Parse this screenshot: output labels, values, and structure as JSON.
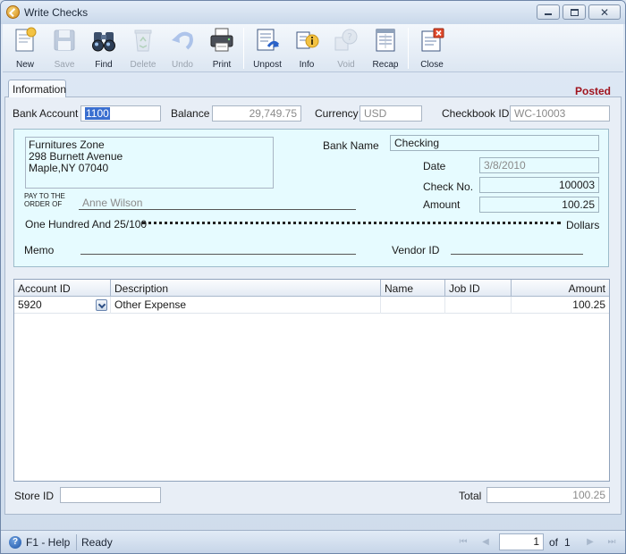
{
  "window": {
    "title": "Write Checks"
  },
  "toolbar": {
    "buttons": [
      {
        "label": "New",
        "icon": "new-document-icon",
        "enabled": true
      },
      {
        "label": "Save",
        "icon": "floppy-disk-icon",
        "enabled": false
      },
      {
        "label": "Find",
        "icon": "binoculars-icon",
        "enabled": true
      },
      {
        "label": "Delete",
        "icon": "recycle-bin-icon",
        "enabled": false
      },
      {
        "label": "Undo",
        "icon": "undo-arrow-icon",
        "enabled": false
      },
      {
        "label": "Print",
        "icon": "printer-icon",
        "enabled": true
      },
      {
        "label": "Unpost",
        "icon": "unpost-ledger-icon",
        "enabled": true
      },
      {
        "label": "Info",
        "icon": "info-icon",
        "enabled": true
      },
      {
        "label": "Void",
        "icon": "void-icon",
        "enabled": false
      },
      {
        "label": "Recap",
        "icon": "recap-ledger-icon",
        "enabled": true
      },
      {
        "label": "Close",
        "icon": "close-window-icon",
        "enabled": true
      }
    ]
  },
  "tab": {
    "label": "Information"
  },
  "status_badge": "Posted",
  "header": {
    "bank_account_label": "Bank Account",
    "bank_account_value": "1100",
    "balance_label": "Balance",
    "balance_value": "29,749.75",
    "currency_label": "Currency",
    "currency_value": "USD",
    "checkbook_id_label": "Checkbook ID",
    "checkbook_id_value": "WC-10003"
  },
  "check": {
    "address_line1": "Furnitures Zone",
    "address_line2": "298 Burnett Avenue",
    "address_line3": "Maple,NY 07040",
    "bank_name_label": "Bank Name",
    "bank_name_value": "Checking",
    "date_label": "Date",
    "date_value": "3/8/2010",
    "check_no_label": "Check No.",
    "check_no_value": "100003",
    "amount_label": "Amount",
    "amount_value": "100.25",
    "pay_to_line1": "PAY TO THE",
    "pay_to_line2": "ORDER OF",
    "payee": "Anne Wilson",
    "amount_words": "One Hundred  And 25/100",
    "dollars_label": "Dollars",
    "memo_label": "Memo",
    "memo_value": "",
    "vendor_id_label": "Vendor ID",
    "vendor_id_value": ""
  },
  "grid": {
    "columns": [
      "Account ID",
      "Description",
      "Name",
      "Job ID",
      "Amount"
    ],
    "rows": [
      {
        "account_id": "5920",
        "description": "Other Expense",
        "name": "",
        "job_id": "",
        "amount": "100.25"
      }
    ]
  },
  "footer": {
    "store_id_label": "Store ID",
    "store_id_value": "",
    "total_label": "Total",
    "total_value": "100.25"
  },
  "statusbar": {
    "help_text": "F1 - Help",
    "status_text": "Ready",
    "page_value": "1",
    "of_text": "of",
    "page_total": "1"
  },
  "colors": {
    "posted": "#a0141e",
    "check_background": "#e6fbff",
    "selection": "#3a6fd0"
  }
}
